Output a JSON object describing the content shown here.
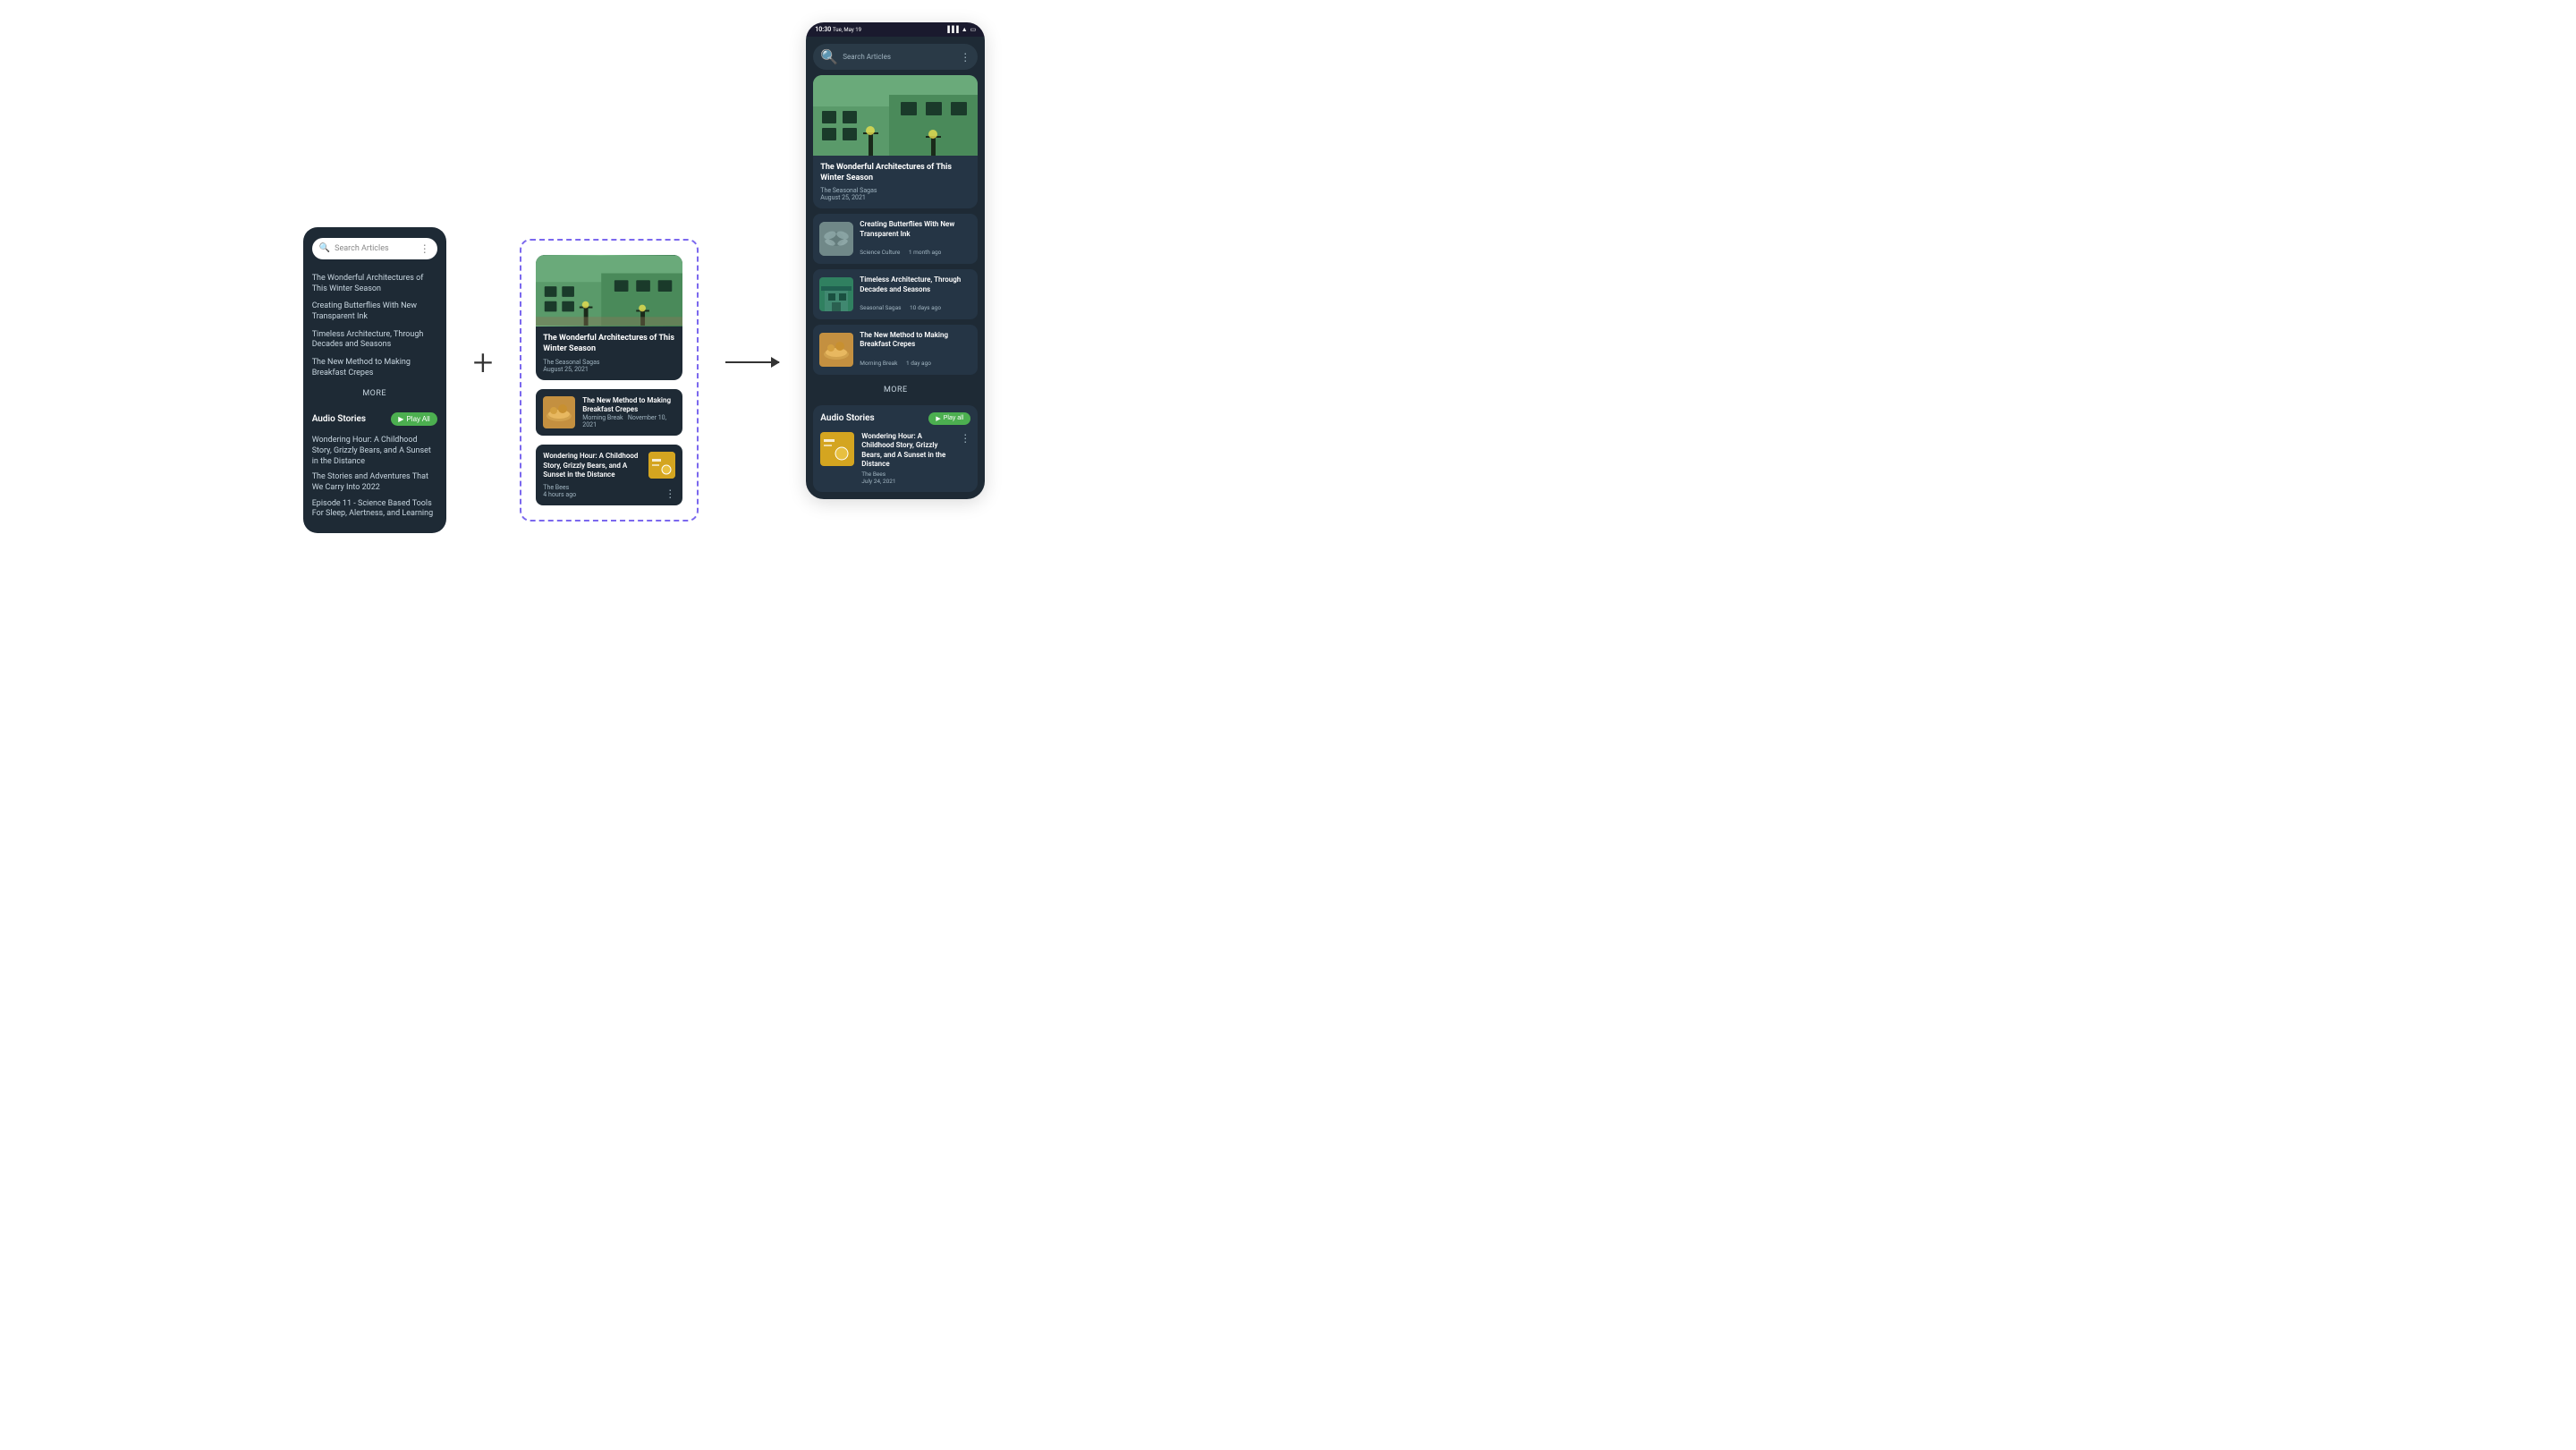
{
  "left_phone": {
    "search_placeholder": "Search Articles",
    "articles": [
      "The Wonderful Architectures of This Winter Season",
      "Creating Butterflies With New Transparent Ink",
      "Timeless Architecture, Through Decades and Seasons",
      "The New Method to Making Breakfast Crepes"
    ],
    "more_label": "MORE",
    "audio_section": {
      "title": "Audio Stories",
      "play_all_label": "Play All",
      "items": [
        "Wondering Hour: A Childhood Story, Grizzly Bears, and A Sunset in the Distance",
        "The Stories and Adventures That We Carry Into 2022",
        "Episode 11 - Science Based Tools For Sleep, Alertness, and Learning"
      ]
    }
  },
  "center_panel": {
    "featured": {
      "title": "The Wonderful Architectures of This Winter Season",
      "source": "The Seasonal Sagas",
      "date": "August 25, 2021"
    },
    "small_cards": [
      {
        "title": "The New Method to Making Breakfast Crepes",
        "source": "Morning Break",
        "date": "November 10, 2021"
      }
    ],
    "audio_card": {
      "title": "Wondering Hour: A Childhood Story, Grizzly Bears, and A Sunset in the Distance",
      "source": "The Bees",
      "time": "4 hours ago"
    }
  },
  "right_phone": {
    "status_bar": {
      "time": "10:30",
      "date": "Tue, May 19"
    },
    "search_placeholder": "Search Articles",
    "featured": {
      "title": "The Wonderful Architectures of This Winter Season",
      "source": "The Seasonal Sagas",
      "date": "August 25, 2021"
    },
    "articles": [
      {
        "title": "Creating Butterflies With New Transparent Ink",
        "source": "Science Culture",
        "time": "1 month ago"
      },
      {
        "title": "Timeless Architecture, Through Decades and Seasons",
        "source": "Seasonal Sagas",
        "time": "10 days ago"
      },
      {
        "title": "The New Method to Making Breakfast Crepes",
        "source": "Morning Break",
        "time": "1 day ago"
      }
    ],
    "more_label": "MORE",
    "audio_section": {
      "title": "Audio Stories",
      "play_all_label": "Play all",
      "item": {
        "title": "Wondering Hour: A Childhood Story, Grizzly Bears, and A Sunset in the Distance",
        "source": "The Bees",
        "date": "July 24, 2021"
      }
    }
  }
}
